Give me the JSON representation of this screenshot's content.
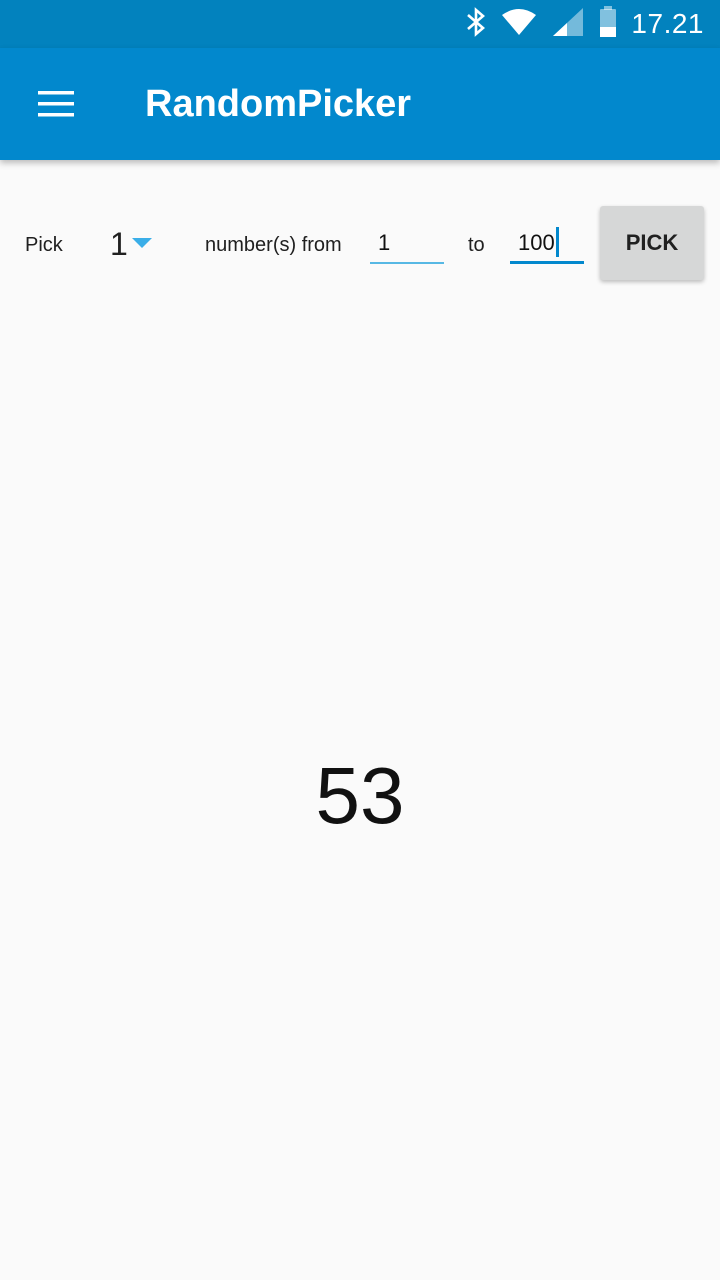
{
  "status_bar": {
    "time": "17.21",
    "icons": [
      "bluetooth-icon",
      "wifi-icon",
      "signal-icon",
      "battery-icon"
    ]
  },
  "app_bar": {
    "title": "RandomPicker",
    "menu_icon": "hamburger-menu-icon"
  },
  "picker_row": {
    "pick_label": "Pick",
    "count_value": "1",
    "numbers_from_label": "number(s) from",
    "from_value": "1",
    "to_label": "to",
    "to_value": "100",
    "pick_button_label": "PICK"
  },
  "result": {
    "value": "53"
  },
  "colors": {
    "status_bar": "#0282be",
    "app_bar": "#0288cd",
    "accent": "#3aaee8",
    "background": "#fafafa",
    "button": "#d6d7d7"
  }
}
